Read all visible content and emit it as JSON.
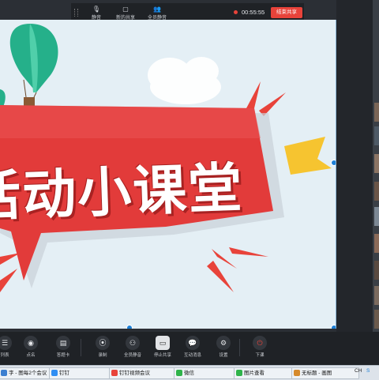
{
  "share_toolbar": {
    "items": [
      {
        "label": "静音",
        "icon": "microphone-icon"
      },
      {
        "label": "新的共享",
        "icon": "new-share-icon"
      },
      {
        "label": "全员静音",
        "icon": "mute-all-icon"
      }
    ],
    "timer": "00:55:55",
    "end_share": "结束共享"
  },
  "slide": {
    "title": "活动小课堂",
    "colors": {
      "bubble": "#e23b3a",
      "accent": "#e8433a",
      "yellow": "#f6c430",
      "balloon": "#25b08a"
    }
  },
  "meeting_toolbar": {
    "items": [
      {
        "label": "列表",
        "icon": "participants-icon"
      },
      {
        "label": "点名",
        "icon": "roll-call-icon"
      },
      {
        "label": "答题卡",
        "icon": "answer-card-icon"
      },
      {
        "label": "录制",
        "icon": "record-icon"
      },
      {
        "label": "全员静音",
        "icon": "mute-all-icon"
      },
      {
        "label": "停止共享",
        "icon": "stop-share-icon"
      },
      {
        "label": "互动消息",
        "icon": "message-icon"
      },
      {
        "label": "设置",
        "icon": "settings-icon"
      },
      {
        "label": "下课",
        "icon": "power-icon"
      }
    ]
  },
  "taskbar": {
    "tasks": [
      {
        "label": "字 - 图每2个会议",
        "color": "#3c7fd0"
      },
      {
        "label": "钉钉",
        "color": "#2f8ef3"
      },
      {
        "label": "钉钉视频会议",
        "color": "#e8433a"
      },
      {
        "label": "微信",
        "color": "#2fb34a"
      },
      {
        "label": "图片查看",
        "color": "#2fb34a"
      },
      {
        "label": "无标题 - 画图",
        "color": "#d68a2c"
      }
    ],
    "tray": [
      "CH",
      "S"
    ]
  }
}
